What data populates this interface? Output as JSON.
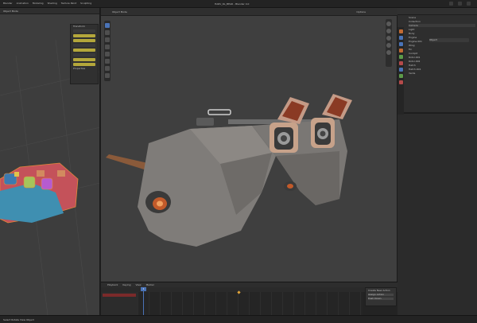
{
  "app": {
    "title": "HARV_RL_BEAR - Blender 4.0",
    "menu": [
      "Blender",
      "Animation",
      "Modeling",
      "Shading",
      "Texture Paint",
      "Sculpting"
    ]
  },
  "left_viewport": {
    "mode_label": "Object Mode",
    "panel_labels": [
      "Transform",
      "Properties"
    ]
  },
  "main_viewport": {
    "mode_label": "Object Mode",
    "view_menu": [
      "View",
      "Select",
      "Add",
      "Object"
    ],
    "options_label": "Options"
  },
  "properties": {
    "outliner_rows": [
      "Scene",
      "Collection",
      "Camera",
      "Light",
      "Body",
      "Engine",
      "Engine.001",
      "Wing",
      "Fin",
      "Cockpit",
      "Rotor.001",
      "Rotor.002",
      "Hatch",
      "Hatch.001",
      "Vents"
    ],
    "field_label": "Object"
  },
  "timeline": {
    "menu": [
      "Playback",
      "Keying",
      "View",
      "Marker"
    ],
    "current_frame": "1",
    "popover": [
      "Create New Action",
      "Assign Action",
      "Push Down"
    ]
  },
  "status": {
    "text": "Select  Rotate View  Object"
  },
  "colors": {
    "accent": "#4a73b7",
    "keyframe": "#e2a53a",
    "yellow": "#b4a73b"
  }
}
